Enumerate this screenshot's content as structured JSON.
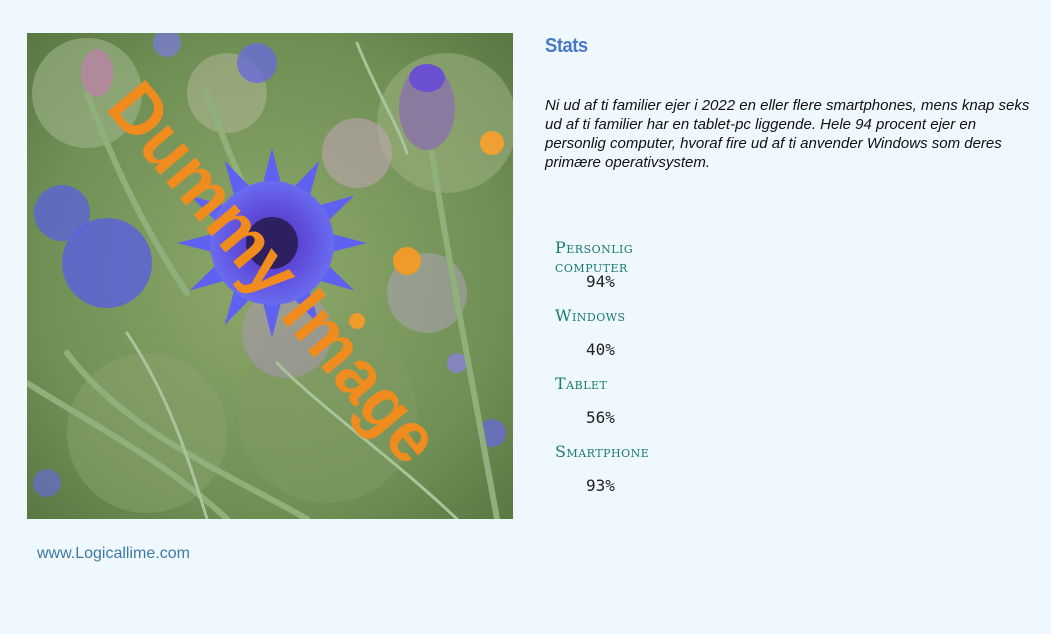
{
  "photo": {
    "watermark": "Dummy Image",
    "watermark_color": "#f08c1e"
  },
  "footer": {
    "link_text": "www.Logicallime.com"
  },
  "stats": {
    "title": "Stats",
    "description": "Ni ud af ti familier ejer i 2022 en eller flere smartphones, mens knap seks ud af ti familier har en tablet-pc liggende. Hele 94 procent ejer en personlig computer, hvoraf fire ud af ti anvender Windows som deres primære operativsystem.",
    "items": [
      {
        "label": "Personlig computer",
        "value": "94%"
      },
      {
        "label": "Windows",
        "value": "40%"
      },
      {
        "label": "Tablet",
        "value": "56%"
      },
      {
        "label": "Smartphone",
        "value": "93%"
      }
    ]
  },
  "colors": {
    "background": "#f0f8ff",
    "title": "#4a78c8",
    "stat_label": "#1a7a6e",
    "link": "#3c7aa3"
  }
}
